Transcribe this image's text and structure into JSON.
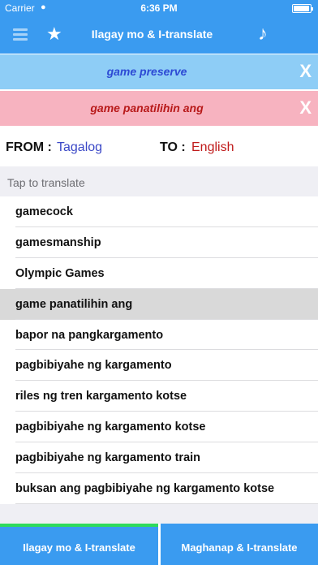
{
  "status_bar": {
    "carrier": "Carrier",
    "wifi": "wifi-icon",
    "time": "6:36 PM",
    "battery": "battery-icon"
  },
  "nav": {
    "title": "Ilagay mo & I-translate",
    "menu_icon": "menu-icon",
    "star_icon": "star-icon",
    "music_icon": "music-note-icon",
    "color": "#3a9bf0"
  },
  "source": {
    "text": "game preserve",
    "close": "X",
    "bg": "#8ecdf6",
    "text_color": "#2d4ad4"
  },
  "result": {
    "text": "game panatilihin ang",
    "close": "X",
    "bg": "#f7b3c0",
    "text_color": "#b81919"
  },
  "languages": {
    "from_label": "FROM :",
    "from_value": "Tagalog",
    "to_label": "TO :",
    "to_value": "English"
  },
  "list": {
    "header": "Tap to translate",
    "items": [
      "gamecock",
      "gamesmanship",
      "Olympic Games",
      "game panatilihin ang",
      "bapor na pangkargamento",
      "pagbibiyahe ng kargamento",
      "riles ng tren kargamento kotse",
      "pagbibiyahe ng kargamento kotse",
      "pagbibiyahe ng kargamento train",
      "buksan ang pagbibiyahe ng kargamento kotse"
    ],
    "selected_item": "game panatilihin ang"
  },
  "tabs": {
    "left": "Ilagay mo & I-translate",
    "right": "Maghanap & I-translate",
    "active": "Ilagay mo & I-translate",
    "active_color": "#2edb5c"
  }
}
